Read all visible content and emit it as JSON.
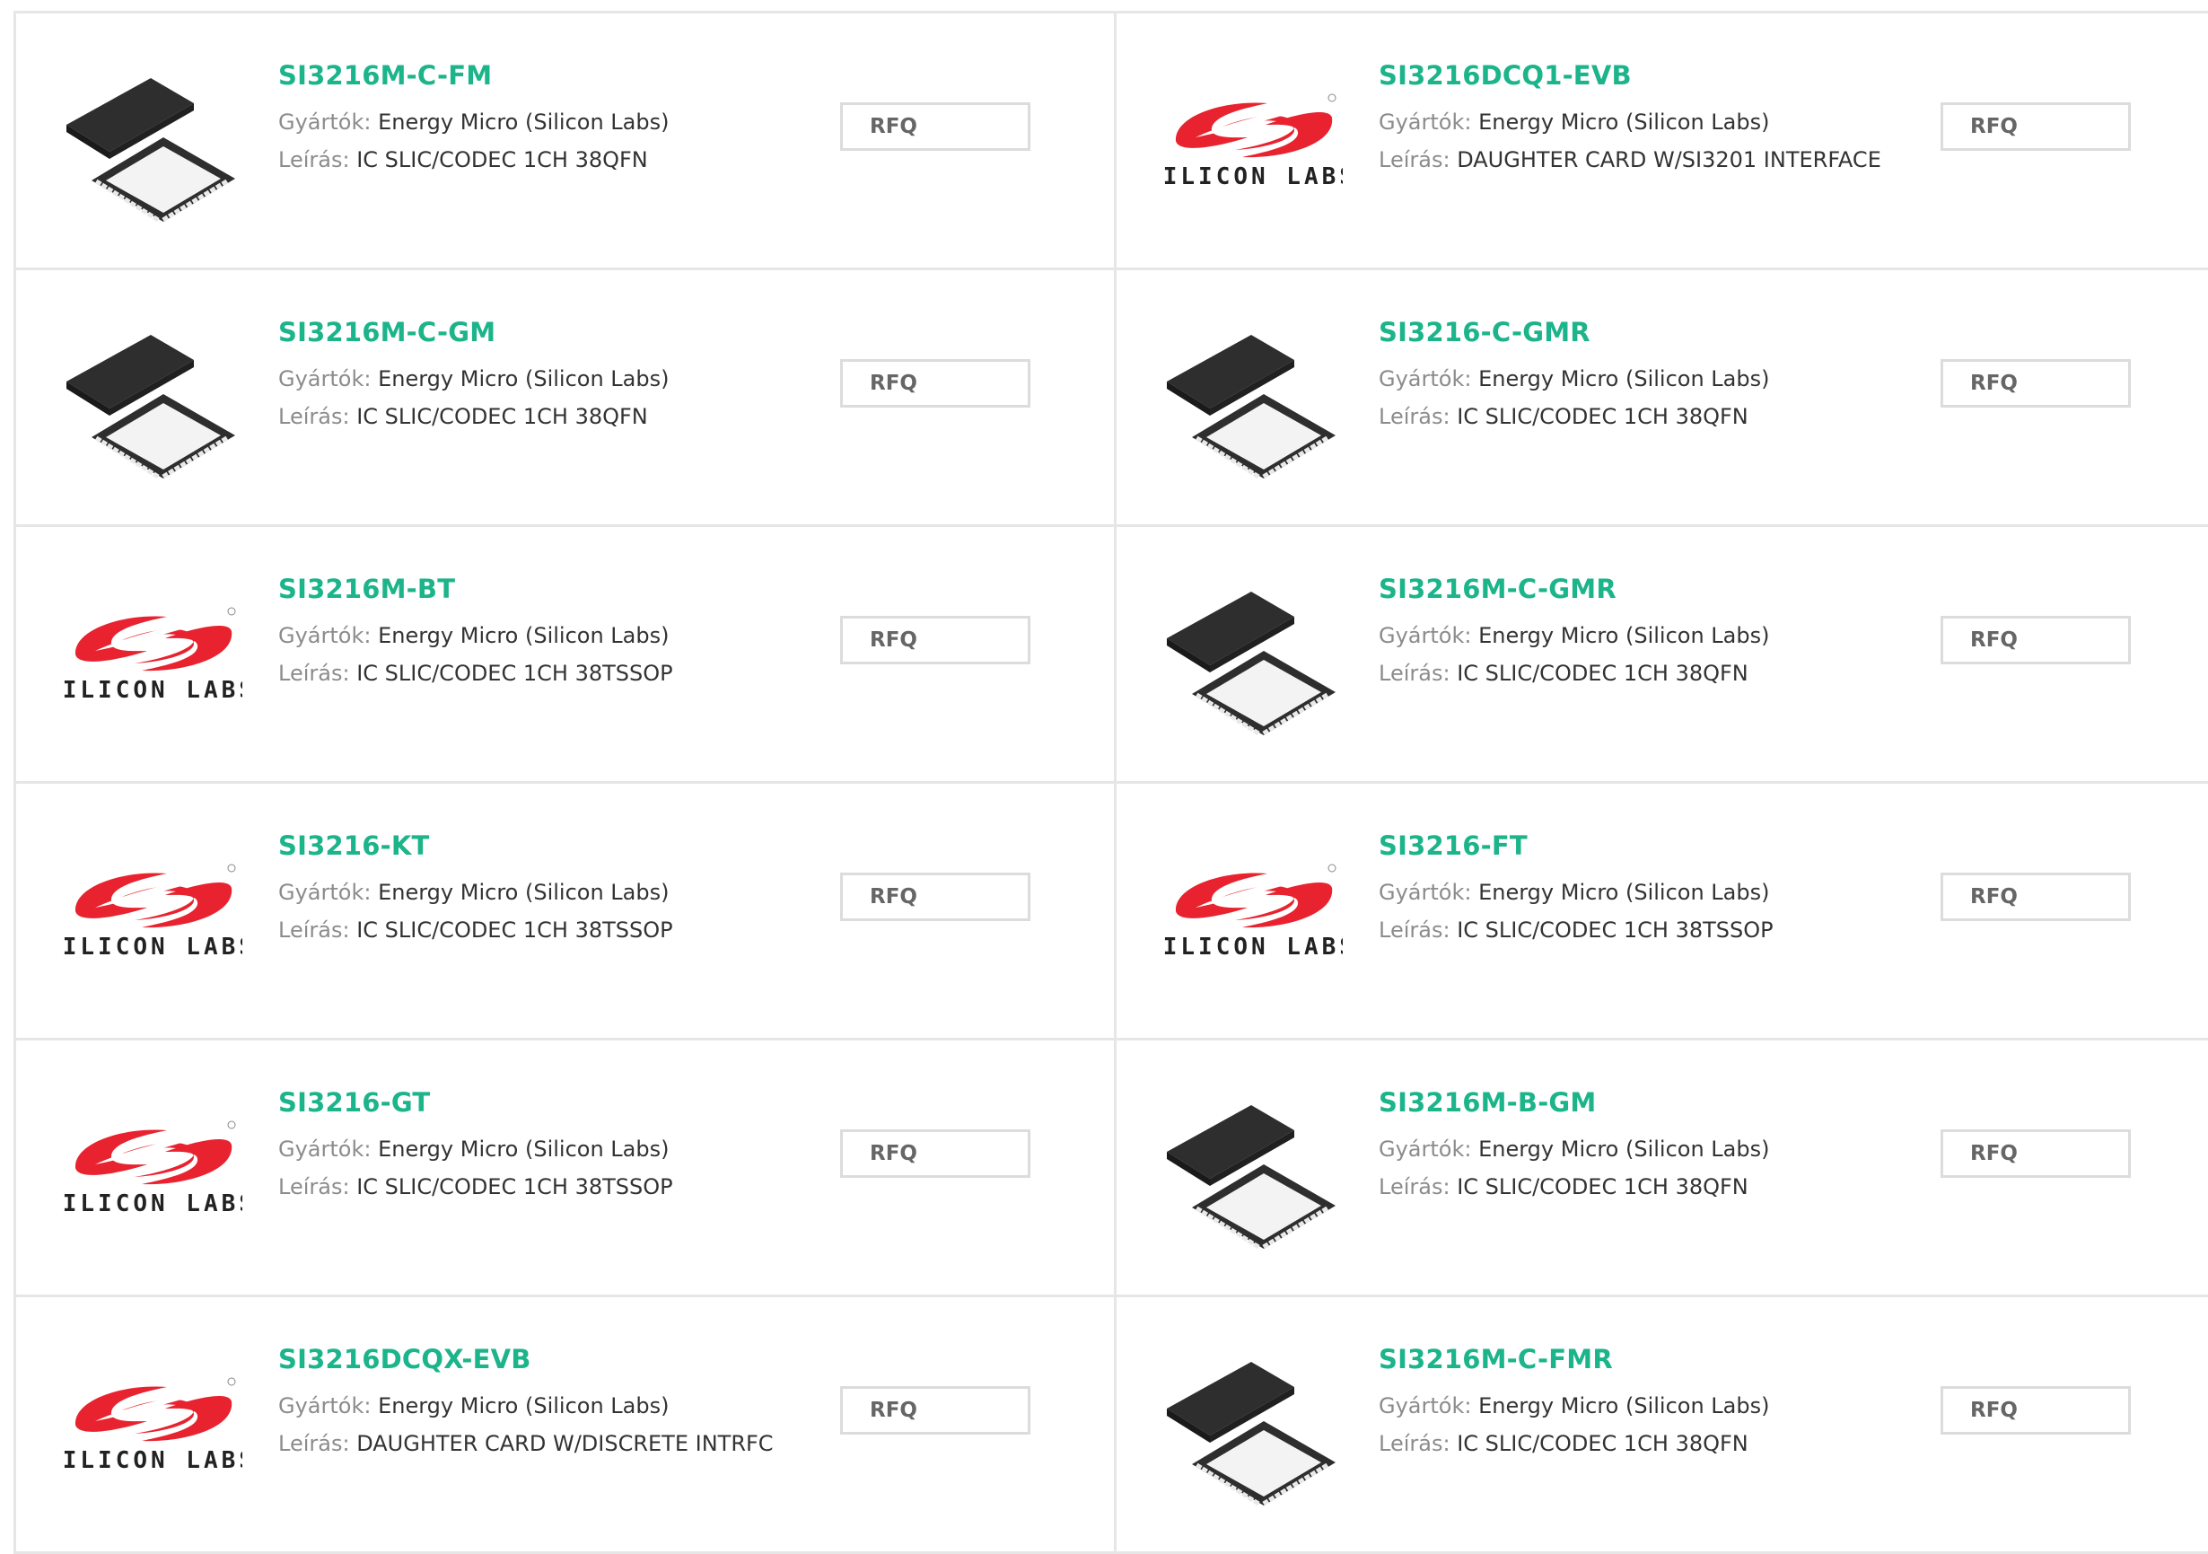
{
  "labels": {
    "manufacturer": "Gyártók:",
    "description": "Leírás:"
  },
  "colors": {
    "accent": "#1cb48a",
    "logo_red": "#e8232f",
    "chip": "#2e2e2e"
  },
  "products": [
    {
      "part": "SI3216M-C-FM",
      "manufacturer": "Energy Micro (Silicon Labs)",
      "description": "IC SLIC/CODEC 1CH 38QFN",
      "image": "chip-icon",
      "rfq": "RFQ"
    },
    {
      "part": "SI3216DCQ1-EVB",
      "manufacturer": "Energy Micro (Silicon Labs)",
      "description": "DAUGHTER CARD W/SI3201 INTERFACE",
      "image": "silicon-labs-logo",
      "rfq": "RFQ"
    },
    {
      "part": "SI3216M-C-GM",
      "manufacturer": "Energy Micro (Silicon Labs)",
      "description": "IC SLIC/CODEC 1CH 38QFN",
      "image": "chip-icon",
      "rfq": "RFQ"
    },
    {
      "part": "SI3216-C-GMR",
      "manufacturer": "Energy Micro (Silicon Labs)",
      "description": "IC SLIC/CODEC 1CH 38QFN",
      "image": "chip-icon",
      "rfq": "RFQ"
    },
    {
      "part": "SI3216M-BT",
      "manufacturer": "Energy Micro (Silicon Labs)",
      "description": "IC SLIC/CODEC 1CH 38TSSOP",
      "image": "silicon-labs-logo",
      "rfq": "RFQ"
    },
    {
      "part": "SI3216M-C-GMR",
      "manufacturer": "Energy Micro (Silicon Labs)",
      "description": "IC SLIC/CODEC 1CH 38QFN",
      "image": "chip-icon",
      "rfq": "RFQ"
    },
    {
      "part": "SI3216-KT",
      "manufacturer": "Energy Micro (Silicon Labs)",
      "description": "IC SLIC/CODEC 1CH 38TSSOP",
      "image": "silicon-labs-logo",
      "rfq": "RFQ"
    },
    {
      "part": "SI3216-FT",
      "manufacturer": "Energy Micro (Silicon Labs)",
      "description": "IC SLIC/CODEC 1CH 38TSSOP",
      "image": "silicon-labs-logo",
      "rfq": "RFQ"
    },
    {
      "part": "SI3216-GT",
      "manufacturer": "Energy Micro (Silicon Labs)",
      "description": "IC SLIC/CODEC 1CH 38TSSOP",
      "image": "silicon-labs-logo",
      "rfq": "RFQ"
    },
    {
      "part": "SI3216M-B-GM",
      "manufacturer": "Energy Micro (Silicon Labs)",
      "description": "IC SLIC/CODEC 1CH 38QFN",
      "image": "chip-icon",
      "rfq": "RFQ"
    },
    {
      "part": "SI3216DCQX-EVB",
      "manufacturer": "Energy Micro (Silicon Labs)",
      "description": "DAUGHTER CARD W/DISCRETE INTRFC",
      "image": "silicon-labs-logo",
      "rfq": "RFQ"
    },
    {
      "part": "SI3216M-C-FMR",
      "manufacturer": "Energy Micro (Silicon Labs)",
      "description": "IC SLIC/CODEC 1CH 38QFN",
      "image": "chip-icon",
      "rfq": "RFQ"
    }
  ],
  "logo_text": "SILICON LABS"
}
